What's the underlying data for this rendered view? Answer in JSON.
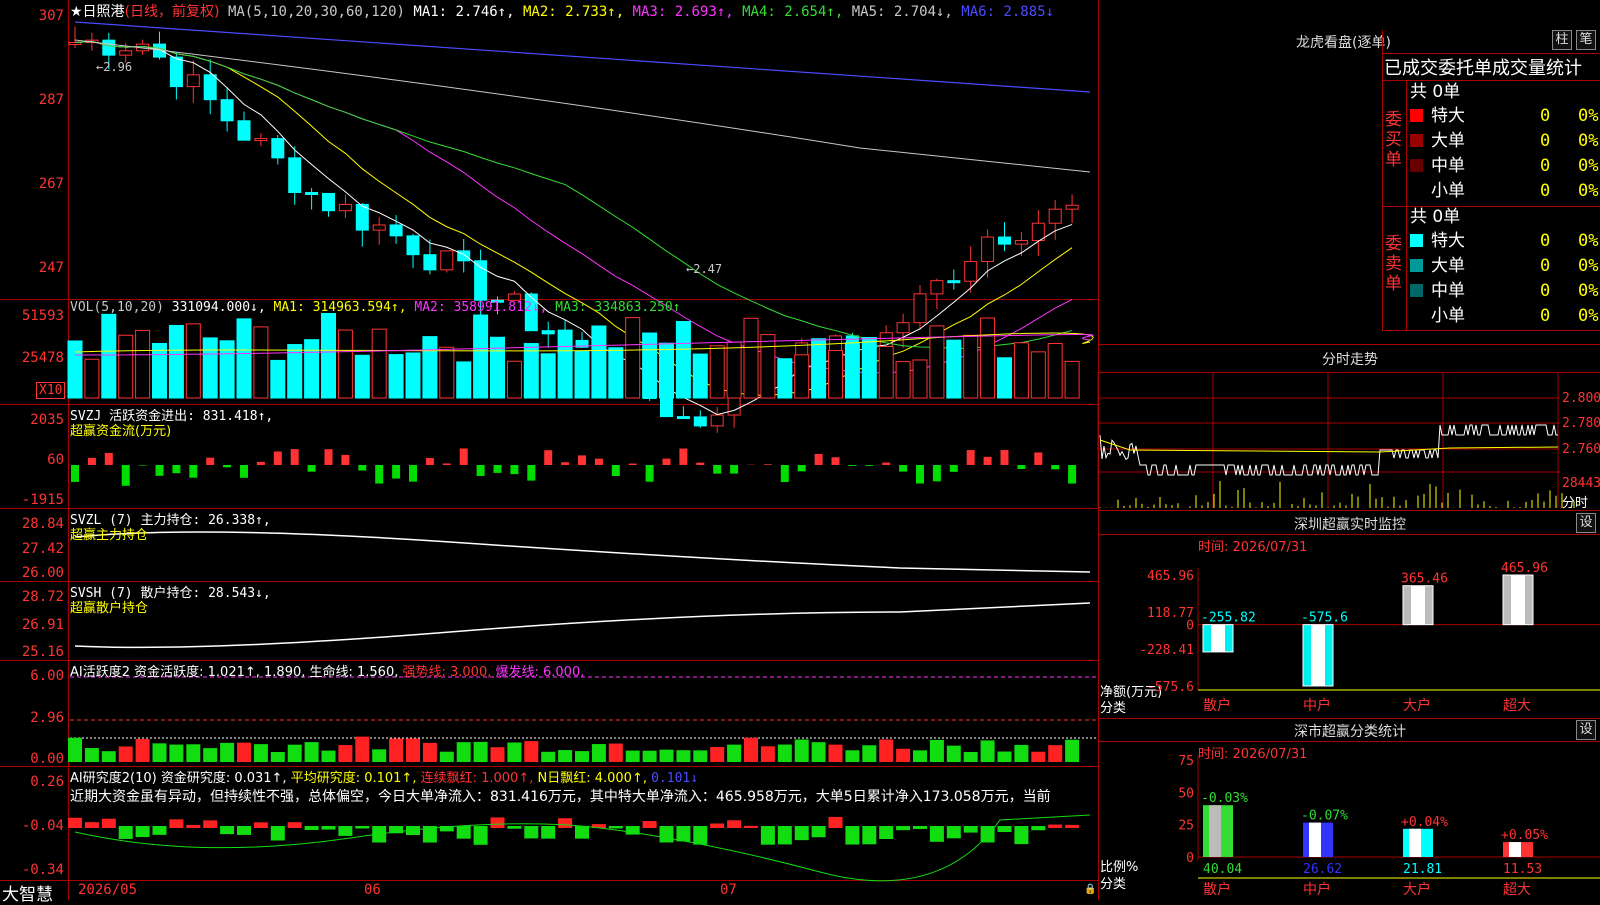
{
  "header": {
    "stock_name": "★日照港",
    "period": "(日线，前复权)",
    "ma_label": "MA(5,10,20,30,60,120)",
    "ma": [
      {
        "text": "MA1: 2.746↑,",
        "color": "#ffffff"
      },
      {
        "text": "MA2: 2.733↑,",
        "color": "#ffff00"
      },
      {
        "text": "MA3: 2.693↑,",
        "color": "#ff33ff"
      },
      {
        "text": "MA4: 2.654↑,",
        "color": "#33dd33"
      },
      {
        "text": "MA5: 2.704↓,",
        "color": "#c8c8c8"
      },
      {
        "text": "MA6: 2.885↓",
        "color": "#4b4bff"
      }
    ]
  },
  "price_axis": [
    "307",
    "287",
    "267",
    "247"
  ],
  "price_annotations": {
    "high": "←2.96",
    "low": "←2.47"
  },
  "volume": {
    "label_prefix": "VOL(5,10,20)",
    "value": "331094.000↓,",
    "ma1": "MA1: 314963.594↑,",
    "ma2": "MA2: 358991.812↓,",
    "ma3": "MA3: 334863.250↑",
    "axis": [
      "51593",
      "25478"
    ],
    "unit": "X10"
  },
  "svzj": {
    "label": "SVZJ  活跃资金进出: 831.418↑,",
    "sublabel": "超赢资金流(万元)",
    "axis": [
      "2035",
      "60",
      "-1915"
    ]
  },
  "svzl": {
    "label": "SVZL (7) 主力持仓: 26.338↑,",
    "sublabel": "超赢主力持仓",
    "axis": [
      "28.84",
      "27.42",
      "26.00"
    ]
  },
  "svsh": {
    "label": "SVSH (7) 散户持仓: 28.543↓,",
    "sublabel": "超赢散户持仓",
    "axis": [
      "28.72",
      "26.91",
      "25.16"
    ]
  },
  "ai_active": {
    "label": "AI活跃度2 资金活跃度: 1.021↑, 1.890, 生命线: 1.560, ",
    "strong": "强势线: 3.000, ",
    "burst": "爆发线: 6.000,",
    "axis": [
      "6.00",
      "2.96",
      "0.00"
    ]
  },
  "ai_research": {
    "prefix": "AI研究度2(10) 资金研究度: 0.031↑, ",
    "avg": "平均研究度: 0.101↑, ",
    "streak": "连续飘红: 1.000↑, ",
    "nday": "N日飘红: 4.000↑, ",
    "last": "0.101↓",
    "comment": "近期大资金虽有异动，但持续性不强，总体偏空，今日大单净流入：831.416万元，其中特大单净流入：465.958万元，大单5日累计净入173.058万元，当前",
    "axis": [
      "0.26",
      "-0.04",
      "-0.34"
    ]
  },
  "date_axis": [
    "2026/05",
    "06",
    "07"
  ],
  "brand": "大智慧",
  "lhb": {
    "title": "龙虎看盘(逐单)",
    "btn_column": "柱",
    "btn_trade": "笔",
    "subtitle": "已成交委托单成交量统计",
    "buy_label": "委买单",
    "sell_label": "委卖单",
    "buy_total": "共 0单",
    "sell_total": "共 0单",
    "buy_rows": [
      {
        "name": "特大",
        "count": "0",
        "pct": "0%",
        "color": "#ff0000"
      },
      {
        "name": "大单",
        "count": "0",
        "pct": "0%",
        "color": "#990000"
      },
      {
        "name": "中单",
        "count": "0",
        "pct": "0%",
        "color": "#660000"
      },
      {
        "name": "小单",
        "count": "0",
        "pct": "0%",
        "color": "#000000"
      }
    ],
    "sell_rows": [
      {
        "name": "特大",
        "count": "0",
        "pct": "0%",
        "color": "#00ffff"
      },
      {
        "name": "大单",
        "count": "0",
        "pct": "0%",
        "color": "#009999"
      },
      {
        "name": "中单",
        "count": "0",
        "pct": "0%",
        "color": "#006666"
      },
      {
        "name": "小单",
        "count": "0",
        "pct": "0%",
        "color": "#000000"
      }
    ]
  },
  "intraday": {
    "title": "分时走势",
    "axis": [
      "2.800",
      "2.780",
      "2.760"
    ],
    "vol_label": "28443",
    "vol_unit": "分时"
  },
  "sz_monitor": {
    "title": "深圳超赢实时监控",
    "setting": "设",
    "time": "时间: 2026/07/31",
    "axis": [
      "465.96",
      "118.77",
      "0",
      "-228.41",
      "-575.6"
    ],
    "ylabel1": "净额(万元)",
    "ylabel2": "分类",
    "chart_data": {
      "type": "bar",
      "categories": [
        "散户",
        "中户",
        "大户",
        "超大"
      ],
      "values": [
        -255.82,
        -575.6,
        365.46,
        465.96
      ],
      "labels": [
        "-255.82",
        "-575.6",
        "365.46",
        "465.96"
      ],
      "ylim": [
        -575.6,
        465.96
      ]
    }
  },
  "sz_stats": {
    "title": "深市超赢分类统计",
    "setting": "设",
    "time": "时间: 2026/07/31",
    "axis": [
      "75",
      "50",
      "25",
      "0"
    ],
    "ylabel1": "比例%",
    "ylabel2": "分类",
    "chart_data": {
      "type": "bar",
      "categories": [
        "散户",
        "中户",
        "大户",
        "超大"
      ],
      "values": [
        40.04,
        26.62,
        21.81,
        11.53
      ],
      "change": [
        "-0.03%",
        "-0.07%",
        "+0.04%",
        "+0.05%"
      ],
      "colors": [
        "#33dd33",
        "#3333ff",
        "#00ffff",
        "#ff3333"
      ],
      "ylim": [
        0,
        75
      ]
    }
  }
}
